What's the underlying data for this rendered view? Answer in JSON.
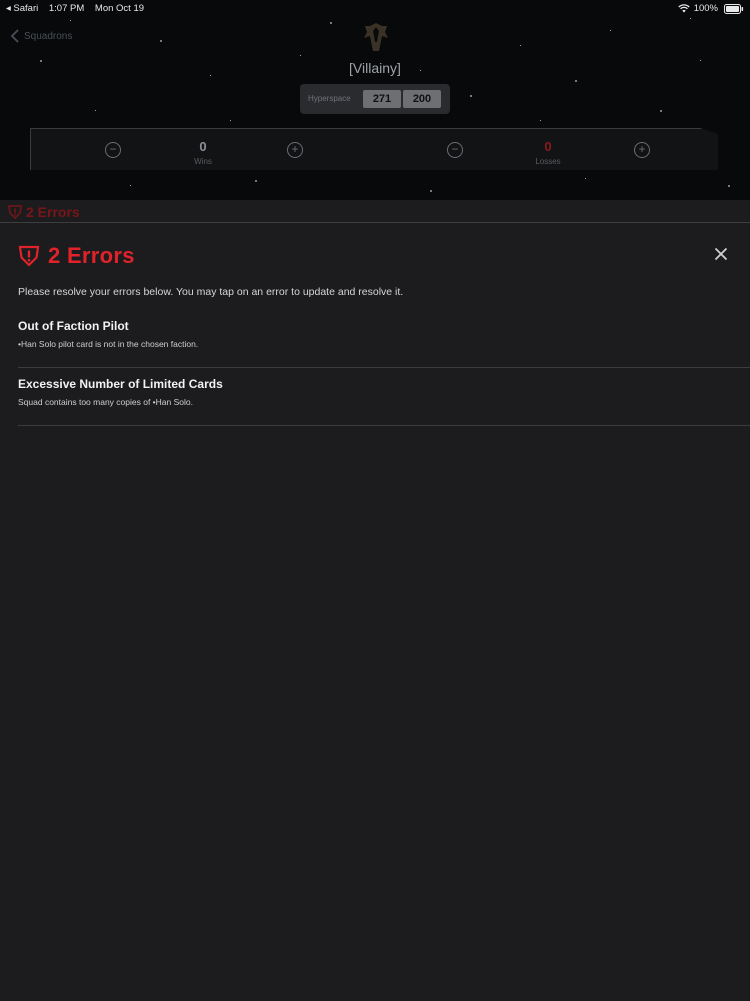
{
  "status_bar": {
    "back_app": "◂ Safari",
    "time": "1:07 PM",
    "date": "Mon Oct 19",
    "battery": "100%"
  },
  "nav": {
    "back_label": "Squadrons"
  },
  "squad": {
    "name": "[Villainy]"
  },
  "points": {
    "format_label": "Hyperspace",
    "current": "271",
    "max": "200"
  },
  "record": {
    "wins_value": "0",
    "wins_label": "Wins",
    "losses_value": "0",
    "losses_label": "Losses"
  },
  "error_strip": {
    "label": "2 Errors"
  },
  "error_sheet": {
    "title": "2 Errors",
    "intro": "Please resolve your errors below. You may tap on an error to update and resolve it.",
    "errors": [
      {
        "title": "Out of Faction Pilot",
        "detail": "•Han Solo pilot card is not in the chosen faction."
      },
      {
        "title": "Excessive Number of Limited Cards",
        "detail": "Squad contains too many copies of •Han Solo."
      }
    ]
  },
  "colors": {
    "error_red": "#e0222a",
    "background": "#1c1c1e"
  },
  "icons": [
    "chevron-left-icon",
    "mandalorian-icon",
    "minus-circle-icon",
    "plus-circle-icon",
    "warning-shield-icon",
    "close-icon",
    "wifi-icon",
    "battery-icon"
  ]
}
